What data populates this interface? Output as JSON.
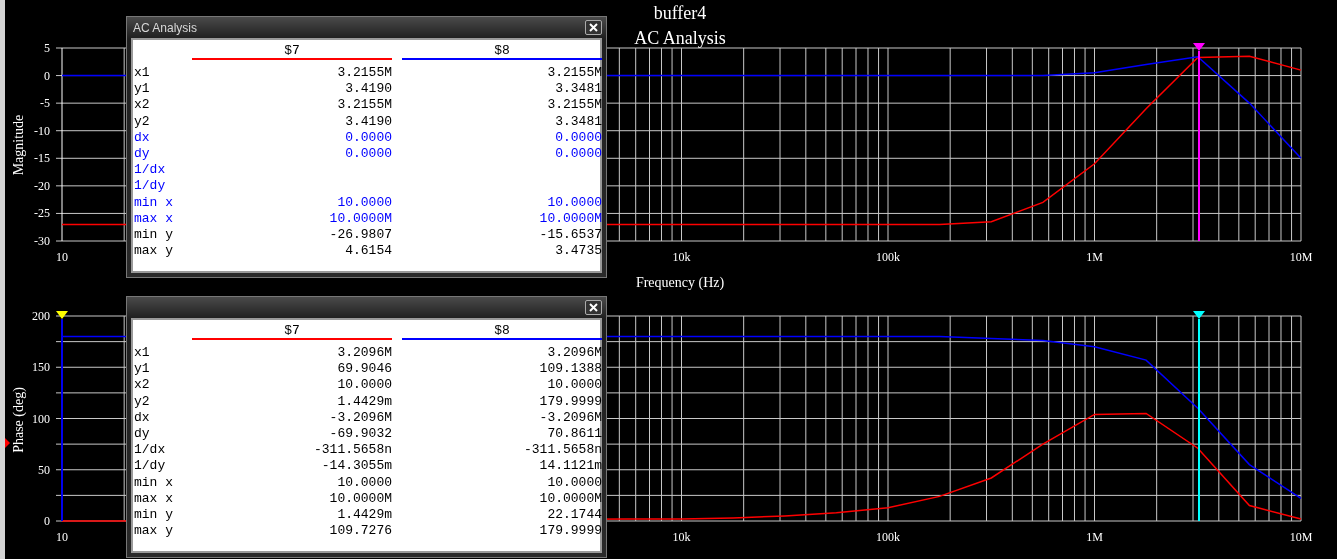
{
  "title": "buffer4",
  "subtitle": "AC Analysis",
  "graphs": [
    {
      "chart_data": {
        "type": "line",
        "ylabel": "Magnitude",
        "xlabel": "Frequency (Hz)",
        "categories": [
          "10",
          null,
          null,
          null,
          null,
          null,
          null,
          null,
          null,
          null,
          null,
          null,
          "10k",
          null,
          null,
          null,
          "100k",
          null,
          null,
          null,
          "1M",
          null,
          null,
          null,
          "10M"
        ],
        "series": [
          {
            "color": "#ff0000",
            "values": [
              -27,
              -27,
              null,
              null,
              null,
              null,
              null,
              null,
              null,
              null,
              null,
              -27,
              -27,
              -27,
              -27,
              -27,
              -27,
              -27,
              -26.5,
              -23,
              -16,
              -6,
              3.3,
              3.5,
              1
            ]
          },
          {
            "color": "#0000ff",
            "values": [
              0,
              0,
              null,
              null,
              null,
              null,
              null,
              null,
              null,
              null,
              null,
              0,
              0,
              0,
              0,
              0,
              0,
              0,
              0,
              0,
              0.5,
              2,
              3.4,
              -5,
              -15
            ]
          }
        ],
        "ylim": [
          -30,
          5
        ],
        "yticks": [
          5,
          0,
          -5,
          -10,
          -15,
          -20,
          -25,
          -30
        ],
        "grid": true
      },
      "cursors": [
        {
          "color": "#ff00ff"
        }
      ]
    },
    {
      "chart_data": {
        "type": "line",
        "ylabel": "Phase (deg)",
        "categories": [
          "10",
          null,
          null,
          null,
          null,
          null,
          null,
          null,
          null,
          null,
          null,
          null,
          "10k",
          null,
          null,
          null,
          "100k",
          null,
          null,
          null,
          "1M",
          null,
          null,
          null,
          "10M"
        ],
        "series": [
          {
            "color": "#ff0000",
            "values": [
              0,
              0,
              null,
              null,
              null,
              null,
              null,
              null,
              null,
              null,
              null,
              2,
              2,
              3,
              5,
              8,
              13,
              24,
              42,
              75,
              104,
              105,
              71,
              15,
              2
            ]
          },
          {
            "color": "#0000ff",
            "values": [
              180,
              180,
              null,
              null,
              null,
              null,
              null,
              null,
              null,
              null,
              null,
              180,
              180,
              180,
              180,
              180,
              180,
              180,
              178,
              176,
              170,
              157,
              110,
              55,
              22
            ]
          }
        ],
        "ylim": [
          0,
          200
        ],
        "yticks": [
          200,
          150,
          100,
          50,
          0
        ],
        "grid": true
      },
      "cursors": [
        {
          "color": "#0000ee",
          "marker": {
            "color": "#ffff00"
          }
        },
        {
          "color": "#00ffff"
        }
      ]
    }
  ],
  "cursor_windows": [
    {
      "title": "AC Analysis",
      "columns": [
        {
          "name": "$7",
          "color": "#ff0000"
        },
        {
          "name": "$8",
          "color": "#0000ff"
        }
      ],
      "rows": [
        {
          "label": "x1",
          "values": [
            "3.2155M",
            "3.2155M"
          ],
          "highlighted": false
        },
        {
          "label": "y1",
          "values": [
            "3.4190",
            "3.3481"
          ],
          "highlighted": false
        },
        {
          "label": "x2",
          "values": [
            "3.2155M",
            "3.2155M"
          ],
          "highlighted": false
        },
        {
          "label": "y2",
          "values": [
            "3.4190",
            "3.3481"
          ],
          "highlighted": false
        },
        {
          "label": "dx",
          "values": [
            "0.0000",
            "0.0000"
          ],
          "highlighted": true
        },
        {
          "label": "dy",
          "values": [
            "0.0000",
            "0.0000"
          ],
          "highlighted": true
        },
        {
          "label": "1/dx",
          "highlighted": true
        },
        {
          "label": "1/dy",
          "highlighted": true
        },
        {
          "label": "min x",
          "values": [
            "10.0000",
            "10.0000"
          ],
          "highlighted": true
        },
        {
          "label": "max x",
          "values": [
            "10.0000M",
            "10.0000M"
          ],
          "highlighted": true
        },
        {
          "label": "min y",
          "values": [
            "-26.9807",
            "-15.6537"
          ],
          "highlighted": false
        },
        {
          "label": "max y",
          "values": [
            "4.6154",
            "3.4735"
          ],
          "highlighted": false
        }
      ]
    },
    {
      "columns": [
        {
          "name": "$7",
          "color": "#ff0000"
        },
        {
          "name": "$8",
          "color": "#0000ff"
        }
      ],
      "rows": [
        {
          "label": "x1",
          "values": [
            "3.2096M",
            "3.2096M"
          ],
          "highlighted": false
        },
        {
          "label": "y1",
          "values": [
            "69.9046",
            "109.1388"
          ],
          "highlighted": false
        },
        {
          "label": "x2",
          "values": [
            "10.0000",
            "10.0000"
          ],
          "highlighted": false
        },
        {
          "label": "y2",
          "values": [
            "1.4429m",
            "179.9999"
          ],
          "highlighted": false
        },
        {
          "label": "dx",
          "values": [
            "-3.2096M",
            "-3.2096M"
          ],
          "highlighted": false
        },
        {
          "label": "dy",
          "values": [
            "-69.9032",
            "70.8611"
          ],
          "highlighted": false
        },
        {
          "label": "1/dx",
          "values": [
            "-311.5658n",
            "-311.5658n"
          ],
          "highlighted": false
        },
        {
          "label": "1/dy",
          "values": [
            "-14.3055m",
            "14.1121m"
          ],
          "highlighted": false
        },
        {
          "label": "min x",
          "values": [
            "10.0000",
            "10.0000"
          ],
          "highlighted": false
        },
        {
          "label": "max x",
          "values": [
            "10.0000M",
            "10.0000M"
          ],
          "highlighted": false
        },
        {
          "label": "min y",
          "values": [
            "1.4429m",
            "22.1744"
          ],
          "highlighted": false
        },
        {
          "label": "max y",
          "values": [
            "109.7276",
            "179.9999"
          ],
          "highlighted": false
        }
      ]
    }
  ]
}
